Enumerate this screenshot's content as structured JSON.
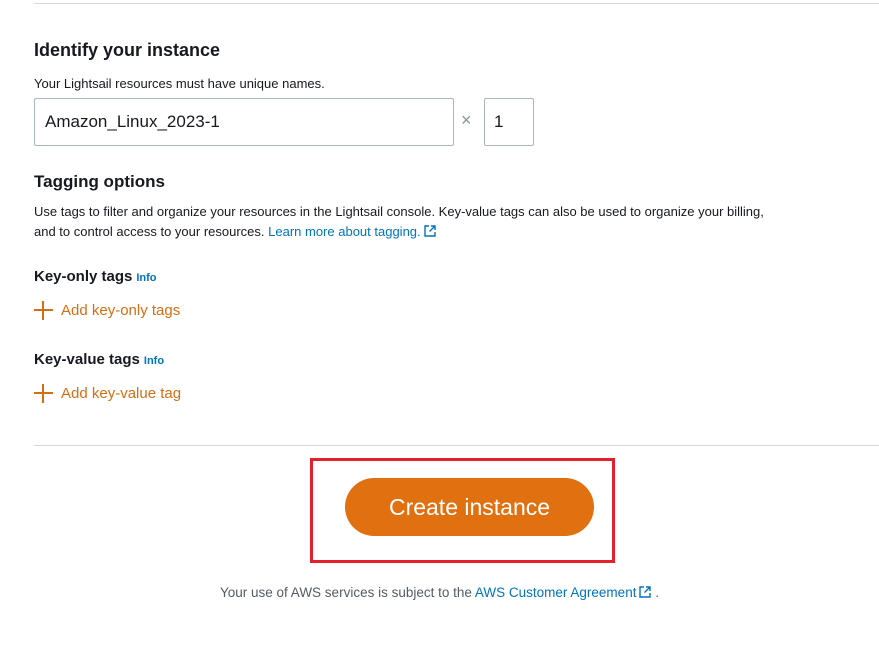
{
  "identify": {
    "title": "Identify your instance",
    "description": "Your Lightsail resources must have unique names.",
    "name_value": "Amazon_Linux_2023-1",
    "times_symbol": "×",
    "quantity_value": "1"
  },
  "tagging": {
    "title": "Tagging options",
    "description": "Use tags to filter and organize your resources in the Lightsail console. Key-value tags can also be used to organize your billing, and to control access to your resources.",
    "learn_more": "Learn more about tagging.",
    "key_only": {
      "title": "Key-only tags",
      "info": "Info",
      "add_label": "Add key-only tags"
    },
    "key_value": {
      "title": "Key-value tags",
      "info": "Info",
      "add_label": "Add key-value tag"
    }
  },
  "actions": {
    "create_label": "Create instance"
  },
  "footer": {
    "text": "Your use of AWS services is subject to the",
    "link": "AWS Customer Agreement",
    "suffix": "."
  },
  "colors": {
    "accent_orange": "#e07010",
    "link_blue": "#0073bb",
    "highlight_red": "#e5202e"
  }
}
